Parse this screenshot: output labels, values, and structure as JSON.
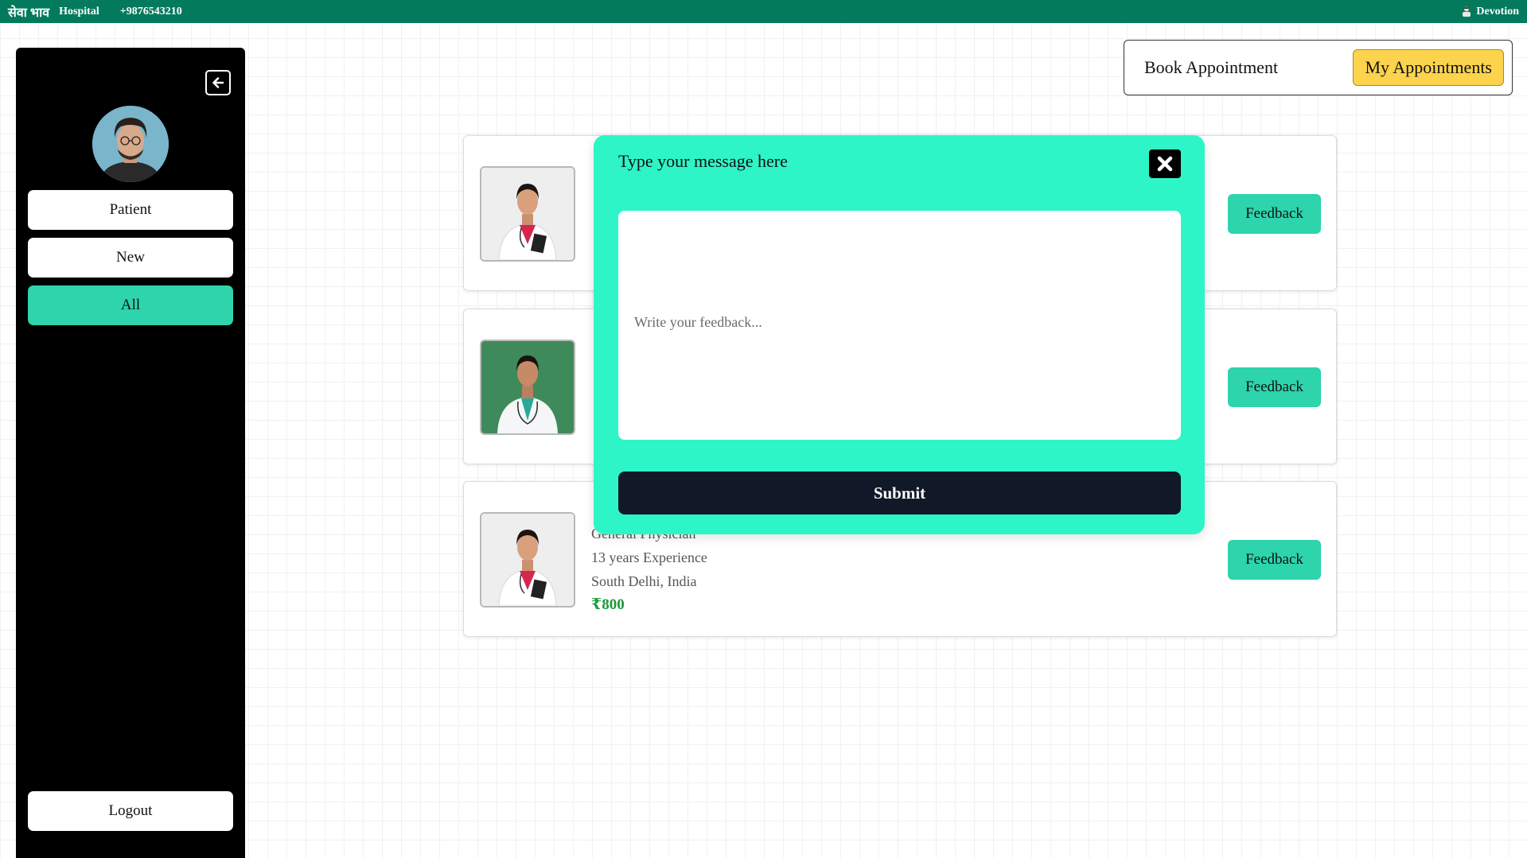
{
  "topbar": {
    "brand": "सेवा भाव",
    "brand_sub": "Hospital",
    "phone": "+9876543210",
    "user_icon": "user-icon",
    "user_name": "Devotion"
  },
  "sidebar": {
    "collapse_icon": "arrow-left-square-icon",
    "avatar": "user-avatar",
    "items": [
      {
        "label": "Patient",
        "active": false
      },
      {
        "label": "New",
        "active": false
      },
      {
        "label": "All",
        "active": true
      }
    ],
    "logout_label": "Logout"
  },
  "nav": {
    "book_label": "Book Appointment",
    "my_label": "My Appointments"
  },
  "appointments": [
    {
      "name": "",
      "specialty": "",
      "experience": "",
      "location": "",
      "fee": "",
      "feedback_label": "Feedback"
    },
    {
      "name": "",
      "specialty": "",
      "experience": "",
      "location": "",
      "fee": "",
      "feedback_label": "Feedback"
    },
    {
      "name": "",
      "specialty": "General Physician",
      "experience": "13 years Experience",
      "location": "South Delhi, India",
      "fee": "₹800",
      "feedback_label": "Feedback"
    }
  ],
  "modal": {
    "title": "Type your message here",
    "close_icon": "close-x-icon",
    "placeholder": "Write your feedback...",
    "value": "",
    "submit_label": "Submit"
  },
  "colors": {
    "topbar": "#037a5c",
    "accent": "#2dd4ac",
    "modal_bg": "#2ef5c7",
    "active_nav": "#fcd34d",
    "submit_bg": "#111827",
    "fee_green": "#1a9a37"
  }
}
